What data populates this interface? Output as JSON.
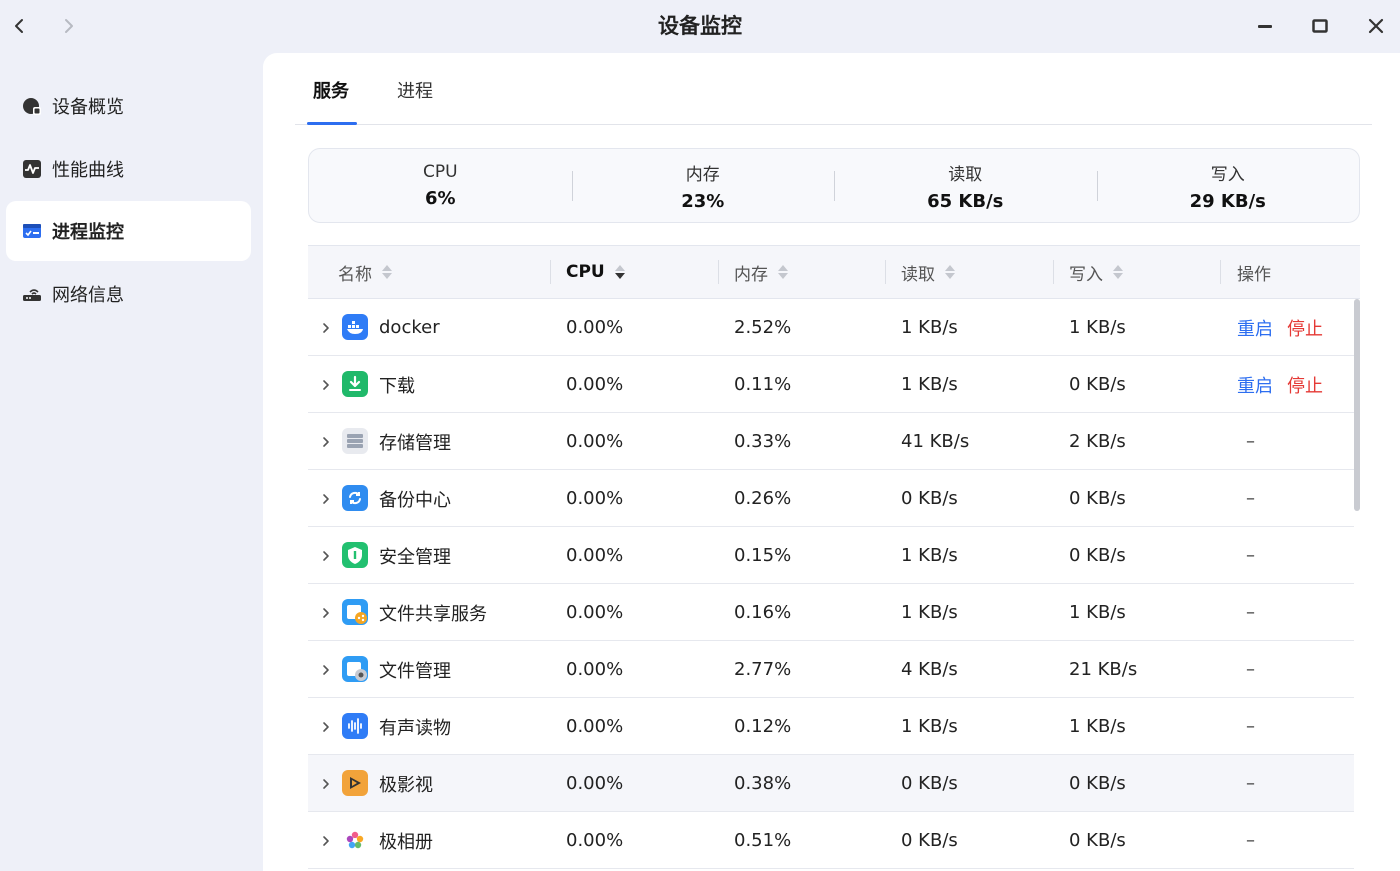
{
  "window": {
    "title": "设备监控"
  },
  "sidebar": {
    "items": [
      {
        "label": "设备概览",
        "icon": "device-overview-icon"
      },
      {
        "label": "性能曲线",
        "icon": "performance-chart-icon"
      },
      {
        "label": "进程监控",
        "icon": "process-monitor-icon"
      },
      {
        "label": "网络信息",
        "icon": "network-router-icon"
      }
    ]
  },
  "tabs": [
    {
      "label": "服务"
    },
    {
      "label": "进程"
    }
  ],
  "summary": [
    {
      "label": "CPU",
      "value": "6%"
    },
    {
      "label": "内存",
      "value": "23%"
    },
    {
      "label": "读取",
      "value": "65 KB/s"
    },
    {
      "label": "写入",
      "value": "29 KB/s"
    }
  ],
  "table": {
    "headers": [
      {
        "label": "名称"
      },
      {
        "label": "CPU"
      },
      {
        "label": "内存"
      },
      {
        "label": "读取"
      },
      {
        "label": "写入"
      },
      {
        "label": "操作"
      }
    ],
    "action_restart": "重启",
    "action_stop": "停止",
    "dash": "–",
    "rows": [
      {
        "name": "docker",
        "cpu": "0.00%",
        "mem": "2.52%",
        "read": "1 KB/s",
        "write": "1 KB/s",
        "actions": true,
        "icon": "docker-icon",
        "color": "#2f7cf6"
      },
      {
        "name": "下载",
        "cpu": "0.00%",
        "mem": "0.11%",
        "read": "1 KB/s",
        "write": "0 KB/s",
        "actions": true,
        "icon": "download-icon",
        "color": "#20b96a"
      },
      {
        "name": "存储管理",
        "cpu": "0.00%",
        "mem": "0.33%",
        "read": "41 KB/s",
        "write": "2 KB/s",
        "actions": false,
        "icon": "storage-icon",
        "color": "#9aa3b2"
      },
      {
        "name": "备份中心",
        "cpu": "0.00%",
        "mem": "0.26%",
        "read": "0 KB/s",
        "write": "0 KB/s",
        "actions": false,
        "icon": "backup-icon",
        "color": "#2f8cf0"
      },
      {
        "name": "安全管理",
        "cpu": "0.00%",
        "mem": "0.15%",
        "read": "1 KB/s",
        "write": "0 KB/s",
        "actions": false,
        "icon": "shield-icon",
        "color": "#22c070"
      },
      {
        "name": "文件共享服务",
        "cpu": "0.00%",
        "mem": "0.16%",
        "read": "1 KB/s",
        "write": "1 KB/s",
        "actions": false,
        "icon": "file-share-icon",
        "color": "#2f9cf4"
      },
      {
        "name": "文件管理",
        "cpu": "0.00%",
        "mem": "2.77%",
        "read": "4 KB/s",
        "write": "21 KB/s",
        "actions": false,
        "icon": "file-manager-icon",
        "color": "#2f9cf4"
      },
      {
        "name": "有声读物",
        "cpu": "0.00%",
        "mem": "0.12%",
        "read": "1 KB/s",
        "write": "1 KB/s",
        "actions": false,
        "icon": "audiobook-icon",
        "color": "#2f7cf6"
      },
      {
        "name": "极影视",
        "cpu": "0.00%",
        "mem": "0.38%",
        "read": "0 KB/s",
        "write": "0 KB/s",
        "actions": false,
        "icon": "video-icon",
        "color": "#f2a33a"
      },
      {
        "name": "极相册",
        "cpu": "0.00%",
        "mem": "0.51%",
        "read": "0 KB/s",
        "write": "0 KB/s",
        "actions": false,
        "icon": "photo-flower-icon",
        "color": "#ffffff"
      }
    ]
  }
}
